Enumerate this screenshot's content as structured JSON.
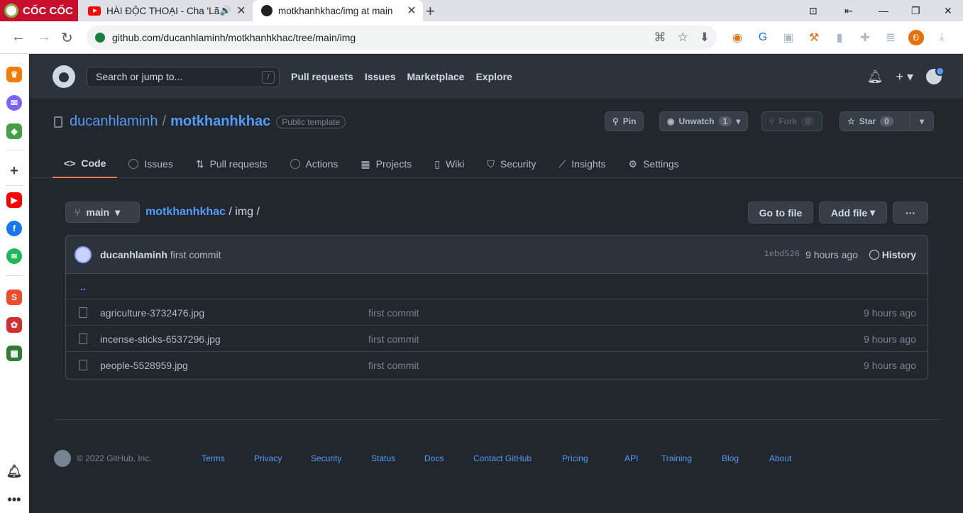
{
  "browser": {
    "brand": "CỐC CỐC",
    "tabs": [
      {
        "title": "HÀI ĐỘC THOẠI - Cha 'Lã",
        "icon": "youtube-icon"
      },
      {
        "title": "motkhanhkhac/img at main",
        "icon": "github-icon"
      }
    ],
    "url": "github.com/ducanhlaminh/motkhanhkhac/tree/main/img",
    "profile_initial": "Đ"
  },
  "github": {
    "search_placeholder": "Search or jump to...",
    "search_key": "/",
    "nav": [
      "Pull requests",
      "Issues",
      "Marketplace",
      "Explore"
    ]
  },
  "repo": {
    "owner": "ducanhlaminh",
    "name": "motkhanhkhac",
    "visibility": "Public template",
    "pin": "Pin",
    "unwatch": "Unwatch",
    "watch_count": "1",
    "fork": "Fork",
    "fork_count": "0",
    "star": "Star",
    "star_count": "0",
    "tabs": [
      "Code",
      "Issues",
      "Pull requests",
      "Actions",
      "Projects",
      "Wiki",
      "Security",
      "Insights",
      "Settings"
    ]
  },
  "browse": {
    "branch": "main",
    "path_repo": "motkhanhkhac",
    "path_dir": "img",
    "go_to_file": "Go to file",
    "add_file": "Add file",
    "more": "···"
  },
  "commit": {
    "author": "ducanhlaminh",
    "message": "first commit",
    "hash": "1ebd526",
    "time": "9 hours ago",
    "history": "History"
  },
  "files": {
    "up": "..",
    "items": [
      {
        "name": "agriculture-3732476.jpg",
        "message": "first commit",
        "age": "9 hours ago"
      },
      {
        "name": "incense-sticks-6537296.jpg",
        "message": "first commit",
        "age": "9 hours ago"
      },
      {
        "name": "people-5528959.jpg",
        "message": "first commit",
        "age": "9 hours ago"
      }
    ]
  },
  "footer": {
    "copyright": "© 2022 GitHub, Inc.",
    "links": [
      "Terms",
      "Privacy",
      "Security",
      "Status",
      "Docs",
      "Contact GitHub",
      "Pricing",
      "API",
      "Training",
      "Blog",
      "About"
    ]
  },
  "colors": {
    "bg": "#22272e",
    "header": "#2d333b",
    "link": "#539bf5",
    "active_tab": "#ec775c"
  }
}
